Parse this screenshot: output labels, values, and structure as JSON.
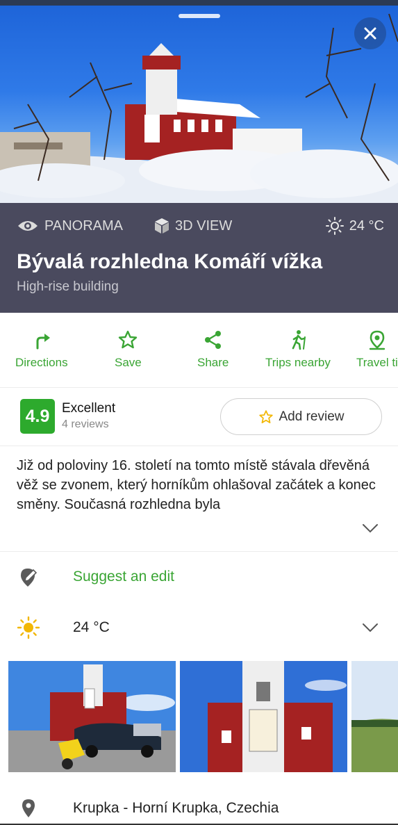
{
  "header": {
    "panorama_label": "PANORAMA",
    "view3d_label": "3D VIEW",
    "weather": "24 °C",
    "title": "Bývalá rozhledna Komáří vížka",
    "subtitle": "High-rise building"
  },
  "actions": [
    {
      "label": "Directions",
      "icon": "directions-icon"
    },
    {
      "label": "Save",
      "icon": "star-icon"
    },
    {
      "label": "Share",
      "icon": "share-icon"
    },
    {
      "label": "Trips nearby",
      "icon": "hiker-icon"
    },
    {
      "label": "Travel ti",
      "icon": "map-pin-icon"
    }
  ],
  "rating": {
    "score": "4.9",
    "label": "Excellent",
    "count": "4 reviews",
    "add_review": "Add review"
  },
  "description": "Již od poloviny 16. století na tomto místě stávala dřevěná věž se zvonem, který horníkům ohlašoval začátek a konec směny. Současná rozhledna byla",
  "suggest_edit": "Suggest an edit",
  "weather_row": "24 °C",
  "address": "Krupka - Horní Krupka, Czechia",
  "colors": {
    "accent": "#3aa534",
    "header_bg": "#4a4a5e",
    "score_bg": "#2daa2d",
    "star": "#f2b705"
  }
}
